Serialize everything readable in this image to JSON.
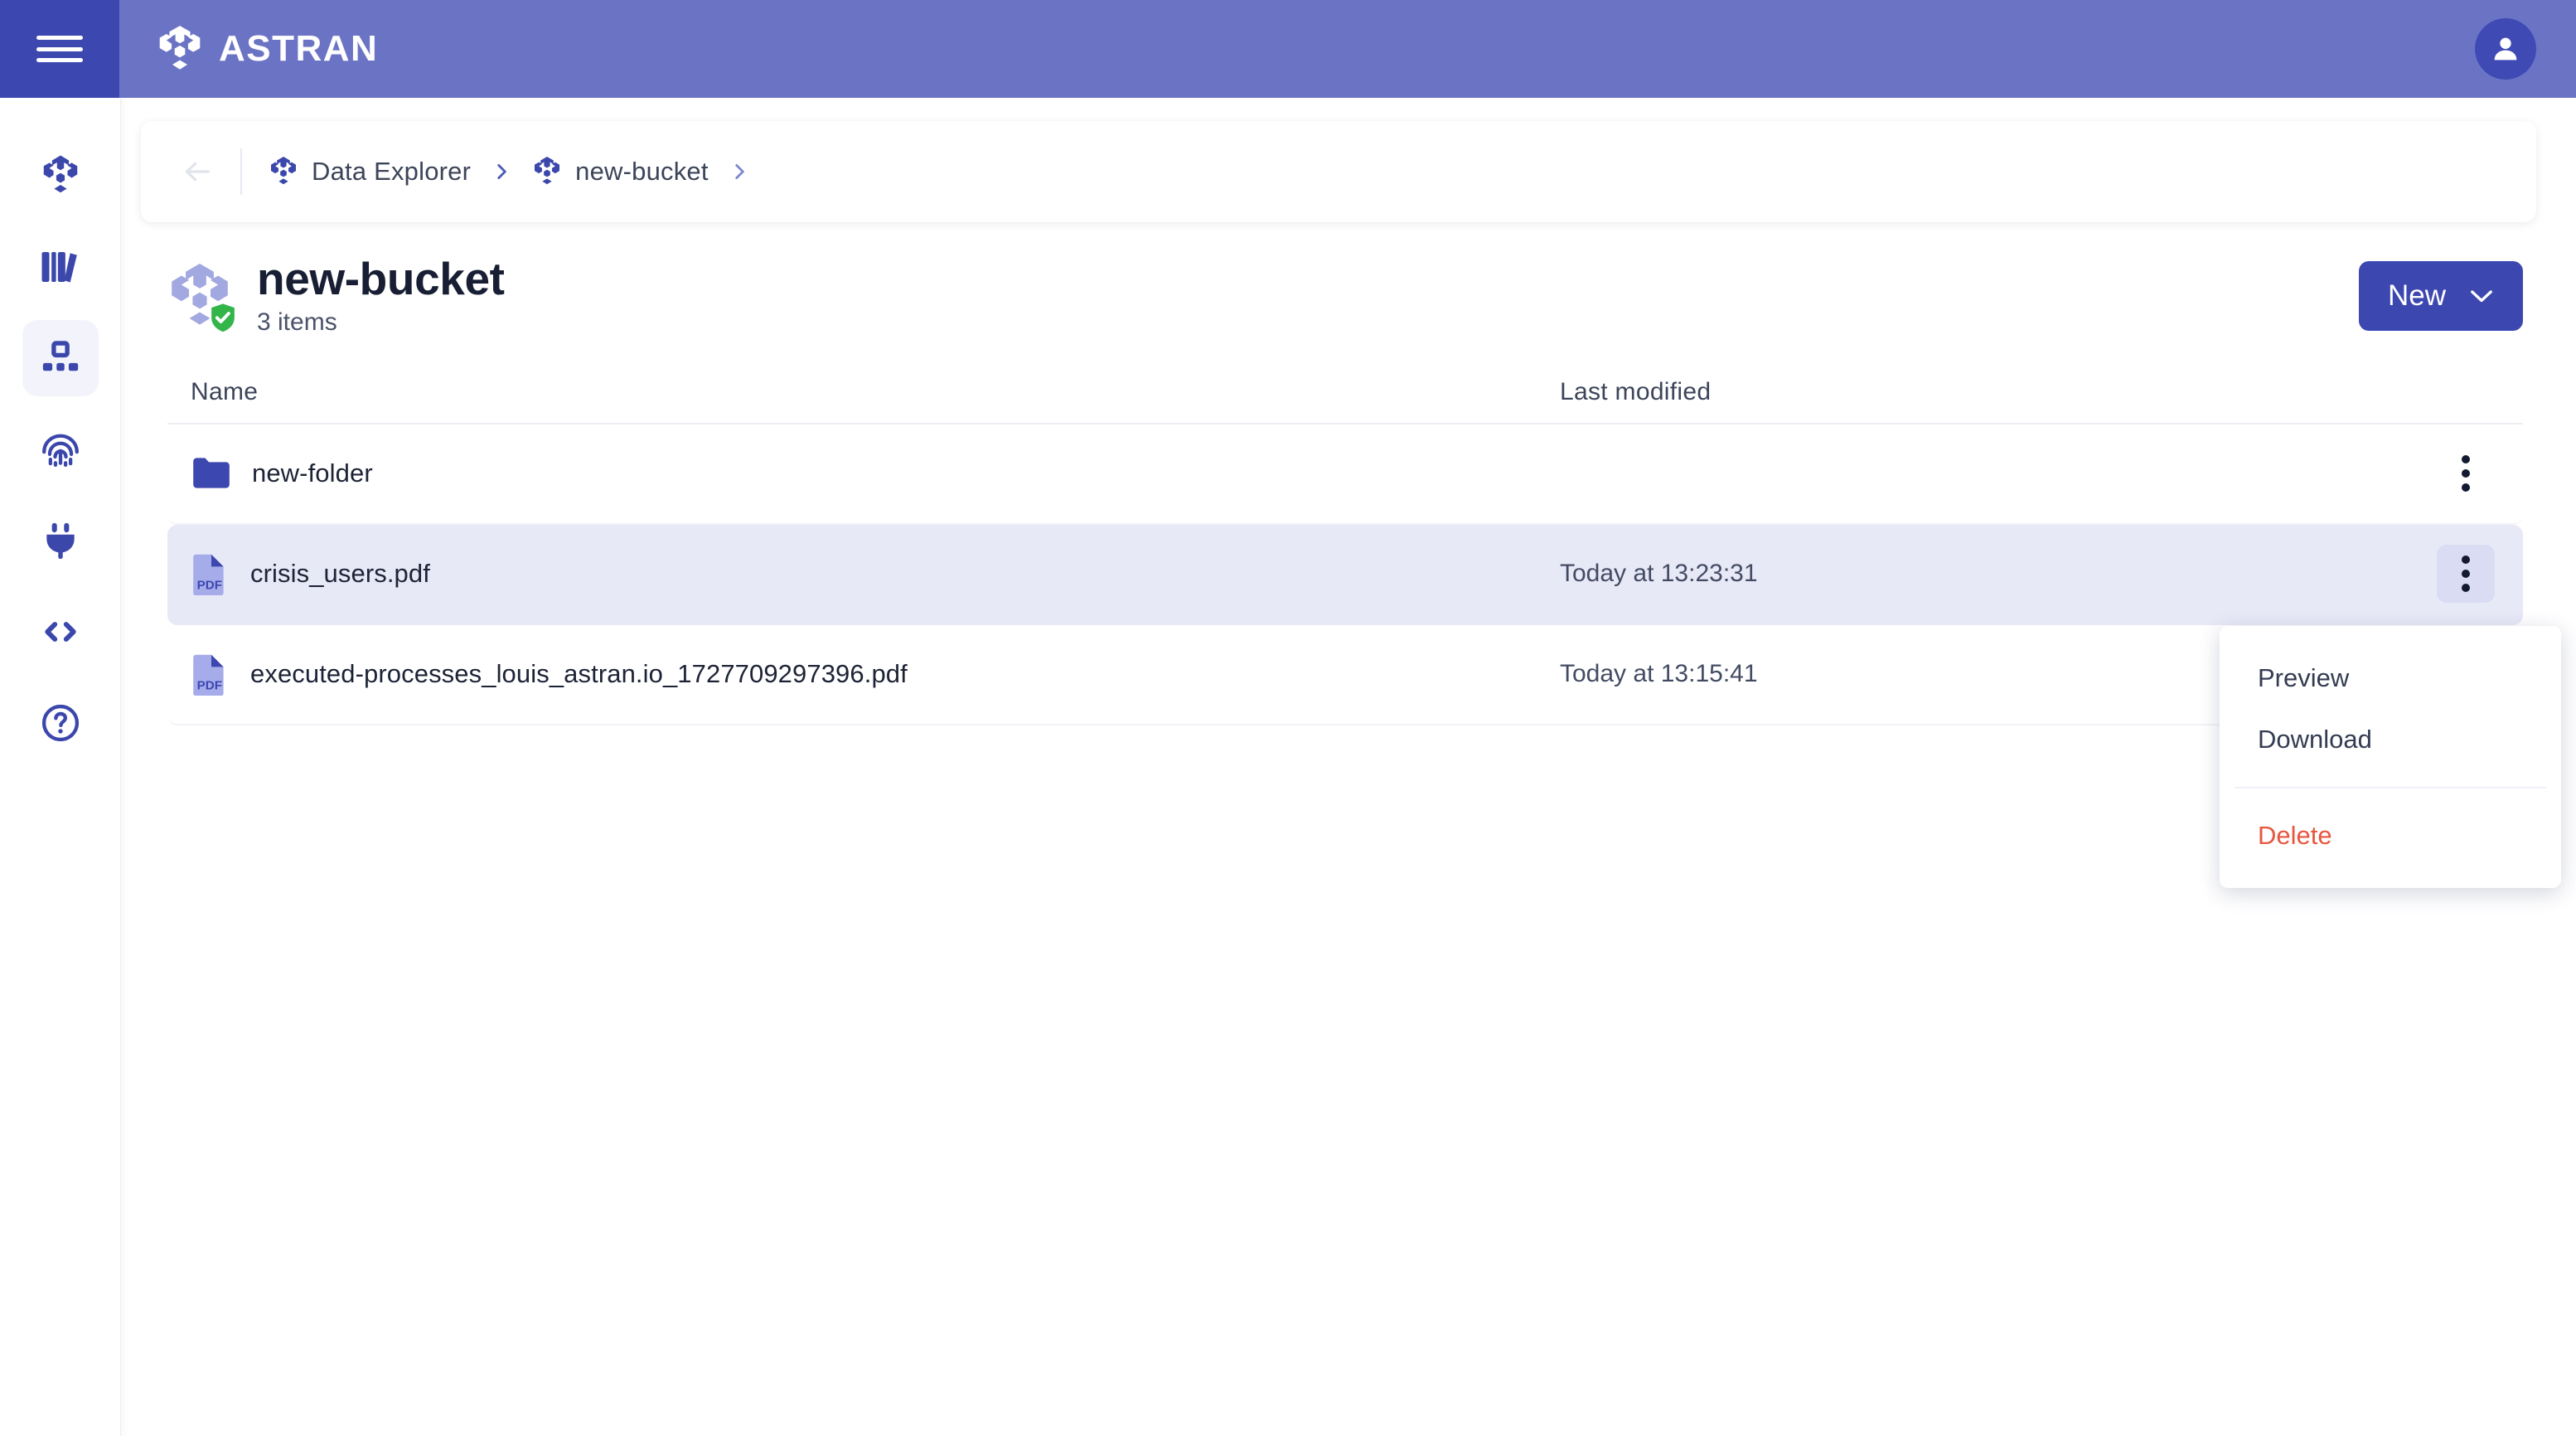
{
  "header": {
    "menu_icon": "hamburger-icon",
    "brand_logo_icon": "astran-hexagon-logo",
    "brand_name": "ASTRAN",
    "avatar_icon": "user-avatar-icon"
  },
  "sidebar": {
    "items": [
      {
        "icon": "astran-hexagon-icon",
        "name": "workspace",
        "active": false
      },
      {
        "icon": "library-books-icon",
        "name": "library",
        "active": false
      },
      {
        "icon": "sitemap-icon",
        "name": "data-explorer",
        "active": true
      },
      {
        "icon": "fingerprint-icon",
        "name": "identity",
        "active": false
      },
      {
        "icon": "plug-icon",
        "name": "integrations",
        "active": false
      },
      {
        "icon": "code-brackets-icon",
        "name": "developers",
        "active": false
      },
      {
        "icon": "help-circle-icon",
        "name": "help",
        "active": false
      }
    ]
  },
  "breadcrumb": {
    "back_icon": "arrow-left-icon",
    "items": [
      {
        "icon": "hexagon-icon",
        "label": "Data Explorer"
      },
      {
        "icon": "hexagon-icon",
        "label": "new-bucket"
      }
    ],
    "separator_icon": "chevron-right-icon"
  },
  "page": {
    "bucket_icon": "bucket-hexagon-icon",
    "status_badge_icon": "shield-check-icon",
    "title": "new-bucket",
    "subtitle": "3 items"
  },
  "toolbar": {
    "new_label": "New",
    "new_chevron_icon": "chevron-down-icon"
  },
  "table": {
    "columns": {
      "name": "Name",
      "last_modified": "Last modified"
    },
    "rows": [
      {
        "icon": "folder-icon",
        "name": "new-folder",
        "last_modified": "",
        "selected": false,
        "menu_icon": "kebab-menu-icon"
      },
      {
        "icon": "pdf-file-icon",
        "name": "crisis_users.pdf",
        "last_modified": "Today at 13:23:31",
        "selected": true,
        "menu_icon": "kebab-menu-icon"
      },
      {
        "icon": "pdf-file-icon",
        "name": "executed-processes_louis_astran.io_1727709297396.pdf",
        "last_modified": "Today at 13:15:41",
        "selected": false,
        "menu_icon": "kebab-menu-icon"
      }
    ]
  },
  "context_menu": {
    "preview": "Preview",
    "download": "Download",
    "delete": "Delete"
  },
  "colors": {
    "brand_dark": "#3d47b0",
    "brand_light": "#6b74c4",
    "accent": "#3c47b0",
    "row_selected": "#e8e9f7",
    "danger": "#e8563f",
    "success": "#33b54a"
  }
}
